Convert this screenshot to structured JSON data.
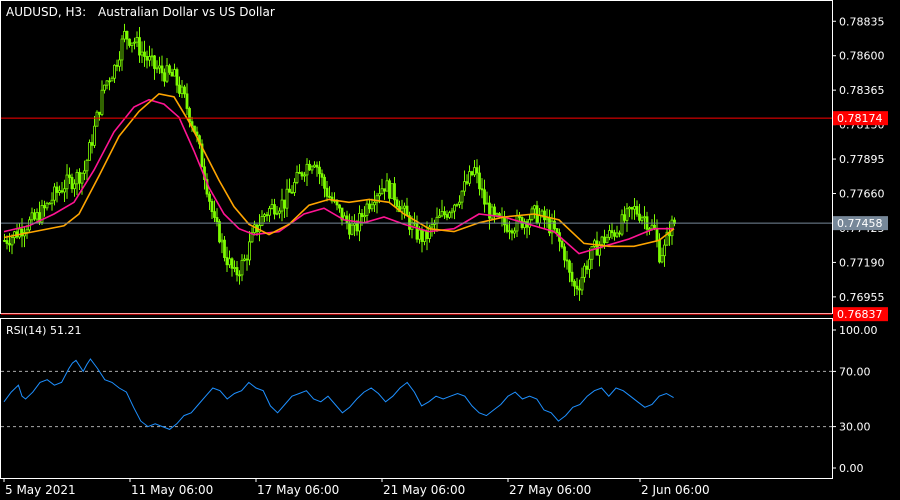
{
  "header": {
    "symbol_timeframe": "AUDUSD, H3:",
    "description": "Australian Dollar vs US Dollar"
  },
  "colors": {
    "background": "#000000",
    "candle": "#7CFC00",
    "ma_fast": "#FF1493",
    "ma_slow": "#FFA500",
    "level_line": "#FF0000",
    "bid_line": "#778899",
    "rsi_line": "#1E90FF",
    "axis": "#ffffff"
  },
  "price_axis": {
    "ticks": [
      "0.78835",
      "0.78600",
      "0.78365",
      "0.78130",
      "0.77895",
      "0.77660",
      "0.77425",
      "0.77190",
      "0.76955"
    ],
    "markers": [
      {
        "label": "0.78174",
        "value": 0.78174,
        "kind": "level"
      },
      {
        "label": "0.77458",
        "value": 0.77458,
        "kind": "bid"
      },
      {
        "label": "0.76837",
        "value": 0.76837,
        "kind": "level"
      }
    ]
  },
  "time_axis": {
    "labels": [
      "5 May 2021",
      "11 May 06:00",
      "17 May 06:00",
      "21 May 06:00",
      "27 May 06:00",
      "2 Jun 06:00"
    ]
  },
  "rsi_panel": {
    "title": "RSI(14) 51.21",
    "ticks": [
      "100.00",
      "70.00",
      "30.00",
      "0.00"
    ],
    "levels": [
      70,
      30
    ]
  },
  "chart_data": [
    {
      "type": "candlestick",
      "title": "AUDUSD, H3:  Australian Dollar vs US Dollar",
      "ylim": [
        0.76845,
        0.7898
      ],
      "horizontal_levels": [
        0.78174,
        0.76837
      ],
      "bid": 0.77458,
      "close_path": [
        [
          0,
          0.7734
        ],
        [
          4,
          0.7738
        ],
        [
          8,
          0.7744
        ],
        [
          12,
          0.7748
        ],
        [
          16,
          0.7755
        ],
        [
          20,
          0.7765
        ],
        [
          24,
          0.7772
        ],
        [
          28,
          0.7776
        ],
        [
          32,
          0.7782
        ],
        [
          36,
          0.781
        ],
        [
          40,
          0.784
        ],
        [
          44,
          0.7852
        ],
        [
          48,
          0.7874
        ],
        [
          52,
          0.787
        ],
        [
          56,
          0.786
        ],
        [
          60,
          0.7852
        ],
        [
          64,
          0.7848
        ],
        [
          68,
          0.7845
        ],
        [
          72,
          0.783
        ],
        [
          76,
          0.781
        ],
        [
          80,
          0.778
        ],
        [
          84,
          0.7745
        ],
        [
          86,
          0.7738
        ],
        [
          88,
          0.7725
        ],
        [
          90,
          0.7718
        ],
        [
          92,
          0.771
        ],
        [
          94,
          0.7715
        ],
        [
          96,
          0.772
        ],
        [
          98,
          0.773
        ],
        [
          100,
          0.774
        ],
        [
          104,
          0.7752
        ],
        [
          108,
          0.7758
        ],
        [
          112,
          0.776
        ],
        [
          116,
          0.7772
        ],
        [
          120,
          0.7784
        ],
        [
          124,
          0.779
        ],
        [
          128,
          0.777
        ],
        [
          132,
          0.7758
        ],
        [
          136,
          0.7748
        ],
        [
          140,
          0.774
        ],
        [
          144,
          0.7755
        ],
        [
          148,
          0.7766
        ],
        [
          152,
          0.7772
        ],
        [
          156,
          0.7765
        ],
        [
          160,
          0.7752
        ],
        [
          164,
          0.774
        ],
        [
          168,
          0.7735
        ],
        [
          172,
          0.7745
        ],
        [
          176,
          0.7752
        ],
        [
          180,
          0.776
        ],
        [
          184,
          0.777
        ],
        [
          188,
          0.7782
        ],
        [
          192,
          0.776
        ],
        [
          196,
          0.7748
        ],
        [
          200,
          0.7745
        ],
        [
          204,
          0.7745
        ],
        [
          208,
          0.7748
        ],
        [
          212,
          0.7752
        ],
        [
          216,
          0.7748
        ],
        [
          220,
          0.774
        ],
        [
          224,
          0.7725
        ],
        [
          226,
          0.771
        ],
        [
          228,
          0.7702
        ],
        [
          230,
          0.7705
        ],
        [
          232,
          0.7715
        ],
        [
          236,
          0.7728
        ],
        [
          240,
          0.7735
        ],
        [
          244,
          0.774
        ],
        [
          248,
          0.7748
        ],
        [
          252,
          0.7755
        ],
        [
          256,
          0.775
        ],
        [
          260,
          0.774
        ],
        [
          262,
          0.7725
        ],
        [
          264,
          0.7728
        ],
        [
          266,
          0.7742
        ],
        [
          268,
          0.7746
        ]
      ],
      "series": [
        {
          "name": "",
          "color": "#FF1493",
          "points": [
            [
              0,
              0.774
            ],
            [
              10,
              0.7744
            ],
            [
              20,
              0.7752
            ],
            [
              28,
              0.776
            ],
            [
              36,
              0.7782
            ],
            [
              44,
              0.7808
            ],
            [
              52,
              0.7825
            ],
            [
              58,
              0.783
            ],
            [
              64,
              0.7827
            ],
            [
              70,
              0.7818
            ],
            [
              76,
              0.7795
            ],
            [
              82,
              0.777
            ],
            [
              88,
              0.7752
            ],
            [
              94,
              0.7742
            ],
            [
              100,
              0.7738
            ],
            [
              110,
              0.774
            ],
            [
              120,
              0.7752
            ],
            [
              128,
              0.7756
            ],
            [
              136,
              0.7748
            ],
            [
              144,
              0.7746
            ],
            [
              152,
              0.775
            ],
            [
              160,
              0.7745
            ],
            [
              170,
              0.774
            ],
            [
              180,
              0.7742
            ],
            [
              190,
              0.7752
            ],
            [
              200,
              0.775
            ],
            [
              210,
              0.7745
            ],
            [
              220,
              0.774
            ],
            [
              230,
              0.7725
            ],
            [
              240,
              0.773
            ],
            [
              250,
              0.7735
            ],
            [
              260,
              0.7742
            ],
            [
              268,
              0.7742
            ]
          ]
        },
        {
          "name": "",
          "color": "#FFA500",
          "points": [
            [
              0,
              0.7736
            ],
            [
              12,
              0.774
            ],
            [
              24,
              0.7744
            ],
            [
              30,
              0.7752
            ],
            [
              38,
              0.7778
            ],
            [
              46,
              0.7805
            ],
            [
              54,
              0.7822
            ],
            [
              62,
              0.7834
            ],
            [
              68,
              0.7832
            ],
            [
              74,
              0.7815
            ],
            [
              80,
              0.7795
            ],
            [
              86,
              0.7775
            ],
            [
              92,
              0.7757
            ],
            [
              98,
              0.7745
            ],
            [
              106,
              0.7738
            ],
            [
              114,
              0.7745
            ],
            [
              122,
              0.7758
            ],
            [
              130,
              0.7762
            ],
            [
              138,
              0.776
            ],
            [
              146,
              0.7762
            ],
            [
              154,
              0.776
            ],
            [
              160,
              0.7752
            ],
            [
              170,
              0.7742
            ],
            [
              180,
              0.774
            ],
            [
              190,
              0.7746
            ],
            [
              200,
              0.775
            ],
            [
              212,
              0.7752
            ],
            [
              222,
              0.7748
            ],
            [
              232,
              0.7732
            ],
            [
              242,
              0.773
            ],
            [
              252,
              0.773
            ],
            [
              262,
              0.7734
            ],
            [
              268,
              0.7742
            ]
          ]
        }
      ]
    },
    {
      "type": "line",
      "title": "RSI(14) 51.21",
      "ylim": [
        0,
        100
      ],
      "levels": [
        70,
        30
      ],
      "series": [
        {
          "name": "",
          "color": "#1E90FF",
          "points": [
            [
              0,
              48
            ],
            [
              4,
              55
            ],
            [
              8,
              60
            ],
            [
              10,
              52
            ],
            [
              12,
              50
            ],
            [
              16,
              55
            ],
            [
              20,
              62
            ],
            [
              24,
              64
            ],
            [
              28,
              60
            ],
            [
              32,
              62
            ],
            [
              36,
              72
            ],
            [
              38,
              76
            ],
            [
              40,
              78
            ],
            [
              44,
              70
            ],
            [
              46,
              75
            ],
            [
              48,
              79
            ],
            [
              52,
              72
            ],
            [
              56,
              64
            ],
            [
              60,
              62
            ],
            [
              64,
              58
            ],
            [
              68,
              55
            ],
            [
              72,
              44
            ],
            [
              76,
              34
            ],
            [
              80,
              30
            ],
            [
              84,
              32
            ],
            [
              88,
              30
            ],
            [
              92,
              28
            ],
            [
              96,
              32
            ],
            [
              100,
              38
            ],
            [
              104,
              40
            ],
            [
              108,
              46
            ],
            [
              112,
              52
            ],
            [
              116,
              58
            ],
            [
              120,
              56
            ],
            [
              124,
              50
            ],
            [
              128,
              54
            ],
            [
              132,
              56
            ],
            [
              136,
              62
            ],
            [
              140,
              58
            ],
            [
              144,
              56
            ],
            [
              148,
              45
            ],
            [
              152,
              40
            ],
            [
              156,
              46
            ],
            [
              160,
              52
            ],
            [
              164,
              54
            ],
            [
              168,
              56
            ],
            [
              172,
              50
            ],
            [
              176,
              48
            ],
            [
              180,
              52
            ],
            [
              184,
              46
            ],
            [
              188,
              40
            ],
            [
              192,
              44
            ],
            [
              196,
              50
            ],
            [
              200,
              55
            ],
            [
              204,
              58
            ],
            [
              208,
              54
            ],
            [
              212,
              48
            ],
            [
              216,
              52
            ],
            [
              220,
              58
            ],
            [
              224,
              62
            ],
            [
              228,
              55
            ],
            [
              232,
              45
            ],
            [
              236,
              48
            ],
            [
              240,
              52
            ],
            [
              244,
              50
            ],
            [
              248,
              52
            ],
            [
              252,
              54
            ],
            [
              256,
              52
            ],
            [
              260,
              45
            ],
            [
              264,
              40
            ],
            [
              268,
              38
            ],
            [
              272,
              42
            ],
            [
              276,
              46
            ],
            [
              280,
              52
            ],
            [
              284,
              55
            ],
            [
              288,
              50
            ],
            [
              292,
              52
            ],
            [
              296,
              50
            ],
            [
              300,
              42
            ],
            [
              304,
              40
            ],
            [
              308,
              34
            ],
            [
              312,
              38
            ],
            [
              316,
              44
            ],
            [
              320,
              46
            ],
            [
              324,
              52
            ],
            [
              328,
              56
            ],
            [
              332,
              58
            ],
            [
              336,
              52
            ],
            [
              340,
              58
            ],
            [
              344,
              56
            ],
            [
              348,
              52
            ],
            [
              352,
              48
            ],
            [
              356,
              44
            ],
            [
              360,
              46
            ],
            [
              364,
              52
            ],
            [
              368,
              54
            ],
            [
              372,
              51
            ]
          ]
        }
      ]
    }
  ]
}
